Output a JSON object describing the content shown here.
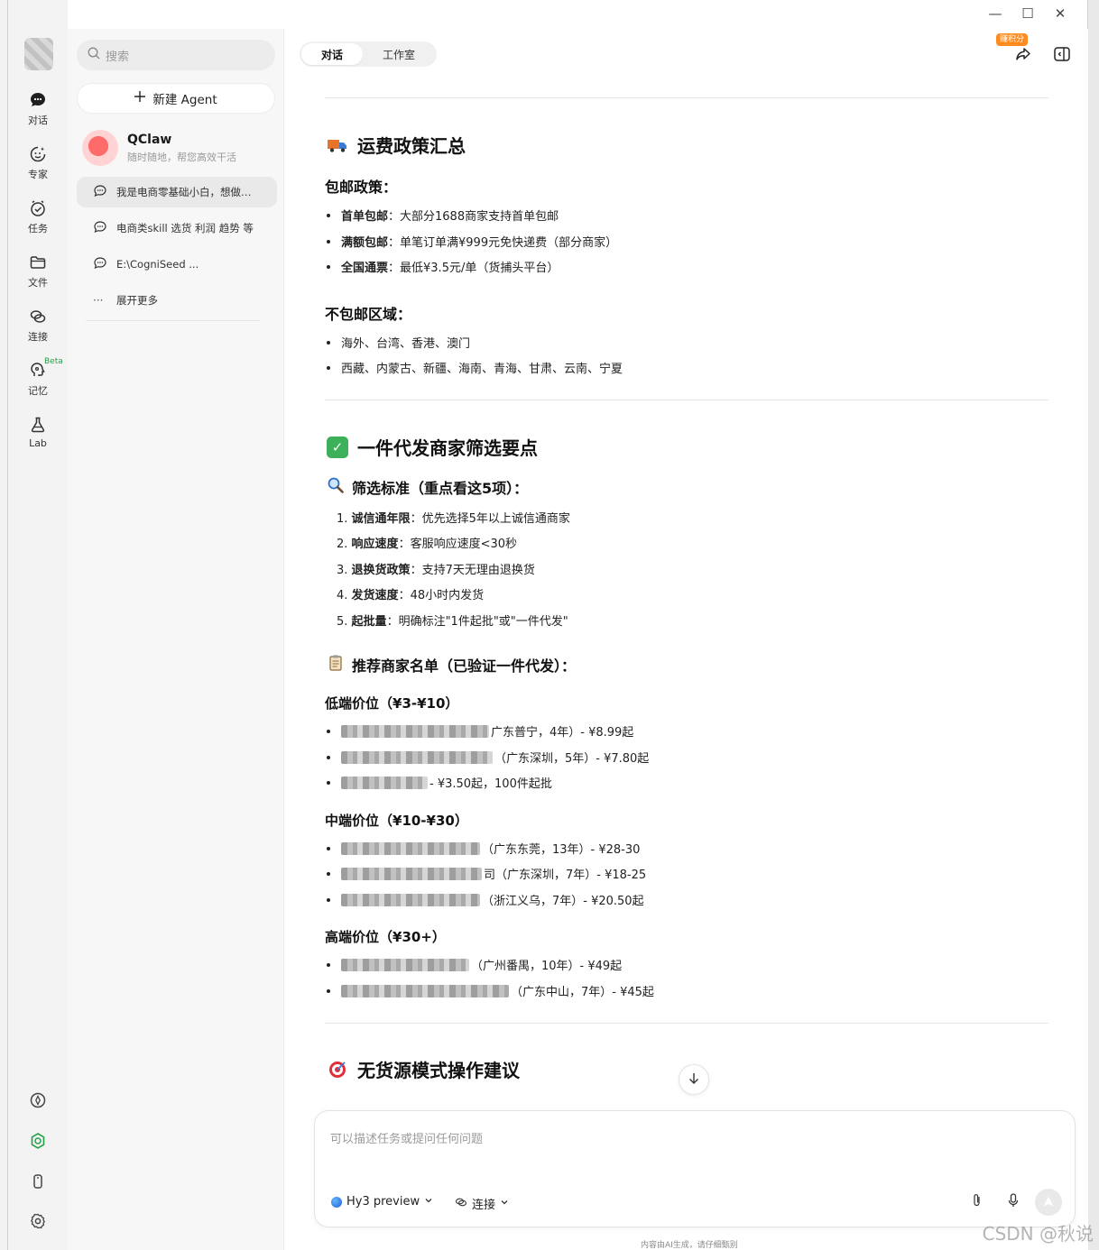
{
  "window": {
    "minimize": "—",
    "maximize": "☐",
    "close": "✕"
  },
  "rail": {
    "items": [
      {
        "label": "对话"
      },
      {
        "label": "专家"
      },
      {
        "label": "任务"
      },
      {
        "label": "文件"
      },
      {
        "label": "连接"
      },
      {
        "label": "记忆",
        "badge": "Beta"
      },
      {
        "label": "Lab"
      }
    ]
  },
  "sidebar": {
    "search_placeholder": "搜索",
    "new_agent": "新建 Agent",
    "agent": {
      "name": "QClaw",
      "subtitle": "随时随地，帮您高效干活"
    },
    "conversations": [
      {
        "title": "我是电商零基础小白，想做…",
        "active": true
      },
      {
        "title": "电商类skill 选货 利润 趋势 等"
      },
      {
        "title": "E:\\CogniSeed ..."
      }
    ],
    "expand_more": "展开更多"
  },
  "header": {
    "tabs": [
      {
        "label": "对话",
        "active": true
      },
      {
        "label": "工作室"
      }
    ],
    "earn_badge": "赚积分"
  },
  "content": {
    "shipping": {
      "title": "运费政策汇总",
      "free_title": "包邮政策：",
      "free_items": [
        {
          "key": "首单包邮",
          "value": "：大部分1688商家支持首单包邮"
        },
        {
          "key": "满额包邮",
          "value": "：单笔订单满¥999元免快递费（部分商家）"
        },
        {
          "key": "全国通票",
          "value": "：最低¥3.5元/单（货捕头平台）"
        }
      ],
      "nofree_title": "不包邮区域：",
      "nofree_items": [
        "海外、台湾、香港、澳门",
        "西藏、内蒙古、新疆、海南、青海、甘肃、云南、宁夏"
      ]
    },
    "merchant": {
      "title": "一件代发商家筛选要点",
      "criteria_title": "筛选标准（重点看这5项）：",
      "criteria": [
        {
          "n": "1.",
          "key": "诚信通年限",
          "value": "：优先选择5年以上诚信通商家"
        },
        {
          "n": "2.",
          "key": "响应速度",
          "value": "：客服响应速度<30秒"
        },
        {
          "n": "3.",
          "key": "退换货政策",
          "value": "：支持7天无理由退换货"
        },
        {
          "n": "4.",
          "key": "发货速度",
          "value": "：48小时内发货"
        },
        {
          "n": "5.",
          "key": "起批量",
          "value": "：明确标注\"1件起批\"或\"一件代发\""
        }
      ],
      "list_title": "推荐商家名单（已验证一件代发）：",
      "low": {
        "title": "低端价位（¥3-¥10）",
        "items": [
          "广东普宁，4年）- ¥8.99起",
          "（广东深圳，5年）- ¥7.80起",
          "- ¥3.50起，100件起批"
        ]
      },
      "mid": {
        "title": "中端价位（¥10-¥30）",
        "items": [
          "（广东东莞，13年）- ¥28-30",
          "司（广东深圳，7年）- ¥18-25",
          "（浙江义乌，7年）- ¥20.50起"
        ]
      },
      "high": {
        "title": "高端价位（¥30+）",
        "items": [
          "（广州番禺，10年）- ¥49起",
          "（广东中山，7年）- ¥45起"
        ]
      }
    },
    "advice": {
      "title": "无货源模式操作建议"
    }
  },
  "composer": {
    "placeholder": "可以描述任务或提问任何问题",
    "model": "Hy3 preview",
    "connect": "连接"
  },
  "disclaimer": "内容由AI生成，请仔细甄别",
  "watermark": "CSDN @秋说",
  "colors": {
    "accent_green": "#24a148",
    "badge_orange": "#ff8a1f"
  }
}
